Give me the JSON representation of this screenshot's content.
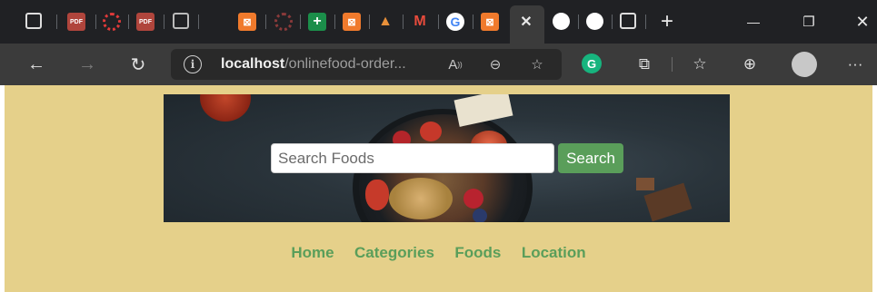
{
  "browser": {
    "tabs": [
      {
        "icon": "tab-actions-icon"
      },
      {
        "icon": "pdf-icon"
      },
      {
        "icon": "opera-icon"
      },
      {
        "icon": "pdf-icon"
      },
      {
        "icon": "tab-page-icon"
      },
      {
        "icon": "xampp-icon"
      },
      {
        "icon": "opera-icon"
      },
      {
        "icon": "green-plus-icon"
      },
      {
        "icon": "xampp-icon"
      },
      {
        "icon": "triangle-logo-icon"
      },
      {
        "icon": "gmail-icon"
      },
      {
        "icon": "google-icon"
      },
      {
        "icon": "xampp-icon"
      },
      {
        "icon": "close-icon",
        "active": true
      },
      {
        "icon": "github-icon"
      },
      {
        "icon": "github-icon"
      },
      {
        "icon": "tab-page-icon"
      }
    ],
    "new_tab_glyph": "+",
    "window_controls": {
      "minimize": "—",
      "restore": "❐",
      "close": "✕"
    },
    "address_bar": {
      "host": "localhost",
      "path": "/onlinefood-order..."
    },
    "nav": {
      "back": "←",
      "forward": "→",
      "reload": "↻"
    },
    "toolbar_icons": [
      "read-aloud-icon",
      "zoom-out-icon",
      "add-favorite-icon",
      "grammarly-icon",
      "extensions-icon",
      "favorites-icon",
      "collections-icon",
      "profile-avatar-icon",
      "more-menu-icon"
    ],
    "more_menu": "···"
  },
  "site": {
    "search": {
      "placeholder": "Search Foods",
      "button_label": "Search"
    },
    "menu": {
      "home": "Home",
      "categories": "Categories",
      "foods": "Foods",
      "location": "Location"
    },
    "colors": {
      "page_bg": "#e5d08a",
      "accent_green": "#5a9e5a",
      "hero_dark": "#2a343b"
    }
  }
}
